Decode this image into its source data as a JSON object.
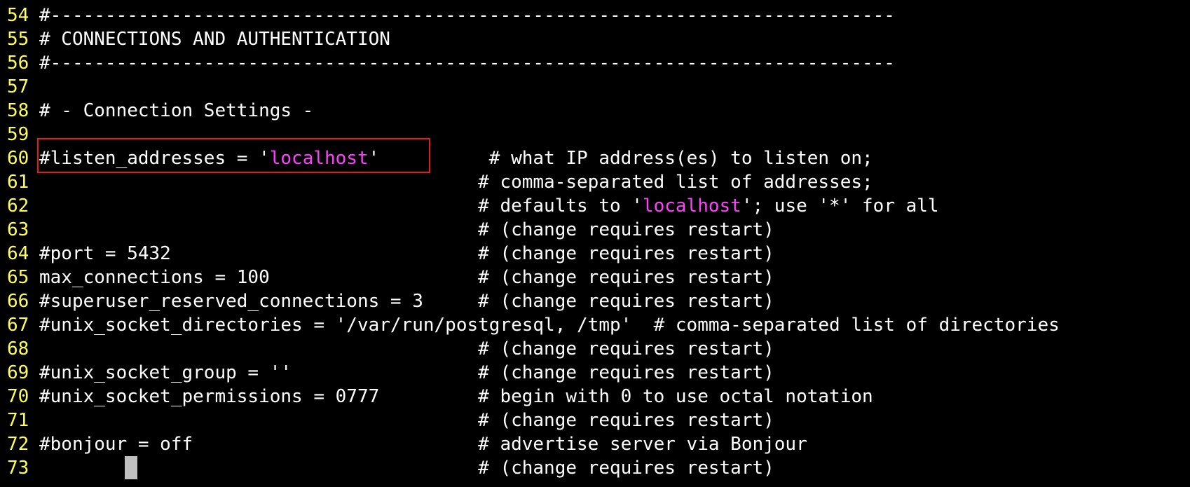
{
  "editor": {
    "lines": [
      {
        "num": "54",
        "segments": [
          "#-----------------------------------------------------------------------------"
        ]
      },
      {
        "num": "55",
        "segments": [
          "# CONNECTIONS AND AUTHENTICATION"
        ]
      },
      {
        "num": "56",
        "segments": [
          "#-----------------------------------------------------------------------------"
        ]
      },
      {
        "num": "57",
        "segments": [
          ""
        ]
      },
      {
        "num": "58",
        "segments": [
          "# - Connection Settings -"
        ]
      },
      {
        "num": "59",
        "segments": [
          ""
        ]
      },
      {
        "num": "60",
        "segments": [
          "#listen_addresses = '",
          "localhost",
          "'          # what IP address(es) to listen on;"
        ]
      },
      {
        "num": "61",
        "segments": [
          "                                        # comma-separated list of addresses;"
        ]
      },
      {
        "num": "62",
        "segments": [
          "                                        # defaults to '",
          "localhost",
          "'; use '*' for all"
        ]
      },
      {
        "num": "63",
        "segments": [
          "                                        # (change requires restart)"
        ]
      },
      {
        "num": "64",
        "segments": [
          "#port = 5432                            # (change requires restart)"
        ]
      },
      {
        "num": "65",
        "segments": [
          "max_connections = 100                   # (change requires restart)"
        ]
      },
      {
        "num": "66",
        "segments": [
          "#superuser_reserved_connections = 3     # (change requires restart)"
        ]
      },
      {
        "num": "67",
        "segments": [
          "#unix_socket_directories = '/var/run/postgresql, /tmp'  # comma-separated list of directories"
        ]
      },
      {
        "num": "68",
        "segments": [
          "                                        # (change requires restart)"
        ]
      },
      {
        "num": "69",
        "segments": [
          "#unix_socket_group = ''                 # (change requires restart)"
        ]
      },
      {
        "num": "70",
        "segments": [
          "#unix_socket_permissions = 0777         # begin with 0 to use octal notation"
        ]
      },
      {
        "num": "71",
        "segments": [
          "                                        # (change requires restart)"
        ]
      },
      {
        "num": "72",
        "segments": [
          "#bonjour = off                          # advertise server via Bonjour"
        ]
      },
      {
        "num": "73",
        "segments": [
          "                                        # (change requires restart)"
        ]
      }
    ]
  },
  "colors": {
    "background": "#000000",
    "text": "#ffffff",
    "line_number": "#ffff55",
    "string_highlight": "#ff40ff",
    "annotation_box": "#e01b24",
    "cursor": "#c0c0c0"
  }
}
